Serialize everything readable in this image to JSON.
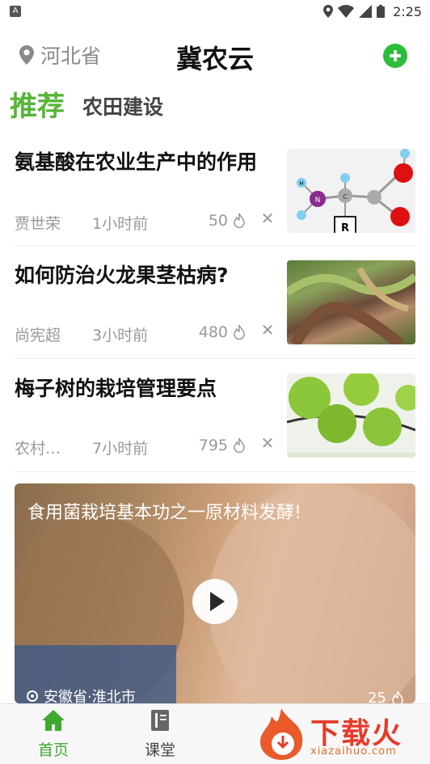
{
  "status_bar": {
    "time": "2:25"
  },
  "header": {
    "location": "河北省",
    "title": "冀农云"
  },
  "tabs": [
    {
      "label": "推荐"
    },
    {
      "label": "农田建设"
    }
  ],
  "articles": [
    {
      "title": "氨基酸在农业生产中的作用",
      "author": "贾世荣",
      "time": "1小时前",
      "heat": "50"
    },
    {
      "title": "如何防治火龙果茎枯病?",
      "author": "尚宪超",
      "time": "3小时前",
      "heat": "480"
    },
    {
      "title": "梅子树的栽培管理要点",
      "author": "农村生...",
      "time": "7小时前",
      "heat": "795"
    }
  ],
  "molecule_labels": {
    "n": "N",
    "h": "H",
    "c": "C",
    "r": "R",
    "o": "O"
  },
  "video": {
    "title": "食用菌栽培基本功之一原材料发酵!",
    "location": "安徽省·淮北市",
    "heat": "25"
  },
  "bottom_nav": [
    {
      "label": "首页"
    },
    {
      "label": "课堂"
    }
  ],
  "watermark": {
    "text": "下载火",
    "url": "xiazaihuo.com"
  },
  "colors": {
    "accent": "#55b535",
    "add_button": "#2cbd3a",
    "nav_active": "#3eaa2f",
    "watermark": "#e53b2a"
  }
}
